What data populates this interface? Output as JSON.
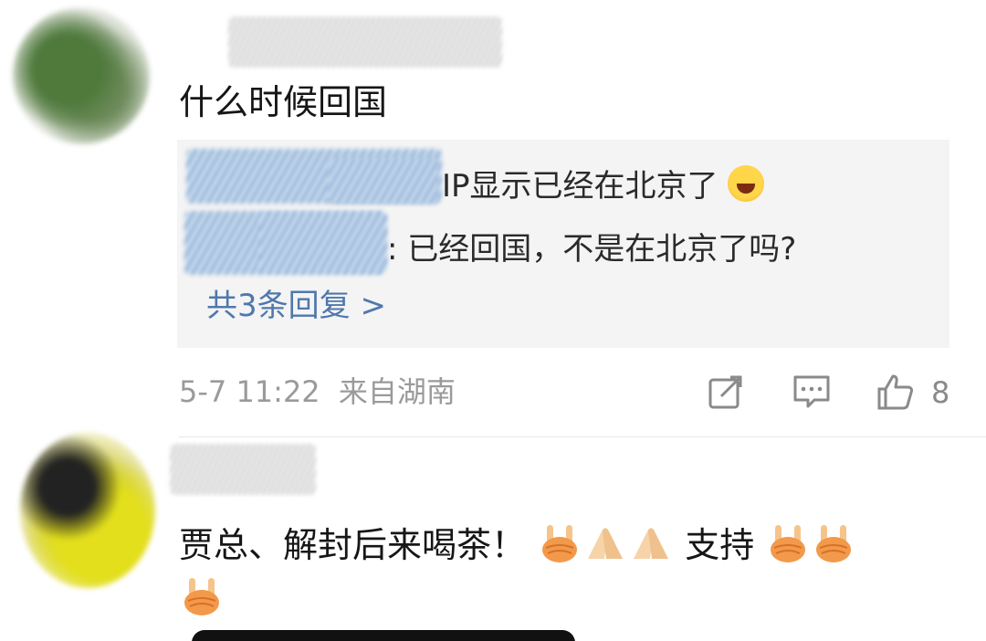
{
  "comments": [
    {
      "text": "什么时候回国",
      "replies": {
        "line1_text": "IP显示已经在北京了",
        "line1_emoji": "grinning-squint-face",
        "line2_text": ": 已经回国，不是在北京了吗?",
        "count_label": "共3条回复 >"
      },
      "meta": {
        "date": "5-7 11:22",
        "location": "来自湖南"
      },
      "likes": "8"
    },
    {
      "text_part1": "贾总、解封后来喝茶！",
      "text_part2": "支持",
      "emoji_sequence": [
        "fist-v-sign",
        "pressed-hands",
        "pressed-hands",
        "fist-v-sign",
        "fist-v-sign",
        "fist-v-sign"
      ]
    }
  ],
  "icons": {
    "share": "share-icon",
    "comment": "comment-icon",
    "like": "thumbs-up-icon"
  },
  "colors": {
    "link_blue": "#5078ac",
    "reply_bg": "#f4f4f4",
    "meta_gray": "#9a9a9a"
  }
}
